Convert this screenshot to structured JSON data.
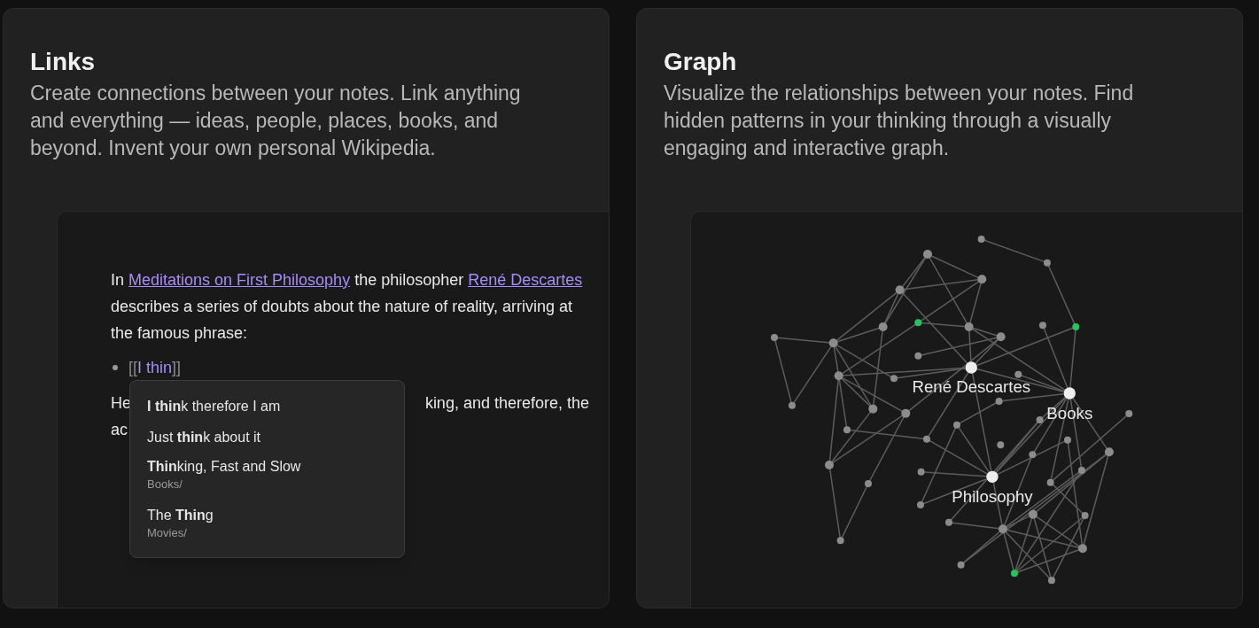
{
  "cards": [
    {
      "kind": "editor",
      "title": "Links",
      "description": "Create connections between your notes. Link anything and everything — ideas, people, places, books, and beyond. Invent your own personal Wikipedia.",
      "paragraph": [
        {
          "kind": "text",
          "text": "In "
        },
        {
          "kind": "link",
          "text": "Meditations on First Philosophy"
        },
        {
          "kind": "text",
          "text": " the philosopher "
        },
        {
          "kind": "link",
          "text": "René Descartes"
        },
        {
          "kind": "text",
          "text": " describes a series of doubts about the nature of reality, arriving at the famous phrase:"
        }
      ],
      "bullet": {
        "open": "[[",
        "text": "I thin",
        "close": "]]"
      },
      "paragraph_2": {
        "line_1_start": "He",
        "line_1_end": "king, and therefore, the",
        "line_2": "ac"
      },
      "suggestions": [
        {
          "title": "**I thin**k therefore I am"
        },
        {
          "title": "Just **thin**k about it"
        },
        {
          "title": "**Thin**king, Fast and Slow",
          "path": "Books/"
        },
        {
          "title": "The **Thin**g",
          "path": "Movies/"
        }
      ]
    },
    {
      "kind": "graph",
      "title": "Graph",
      "description": "Visualize the relationships between your notes. Find hidden patterns in your thinking through a visually engaging and interactive graph.",
      "labels": [
        "René Descartes",
        "Books",
        "Philosophy"
      ]
    }
  ]
}
